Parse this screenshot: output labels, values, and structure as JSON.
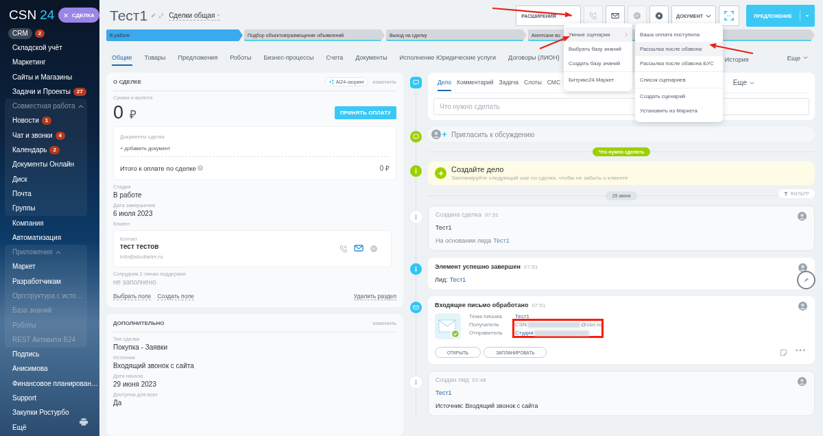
{
  "sidebar": {
    "logo": {
      "name": "CSN",
      "number": "24"
    },
    "close_button": {
      "icon": "×",
      "label": "СДЕЛКА"
    },
    "items": [
      {
        "kind": "link",
        "label": "CRM",
        "badge": "2",
        "selected": true,
        "dimmed": false
      },
      {
        "kind": "link",
        "label": "Складской учёт",
        "selected": false,
        "dimmed": false
      },
      {
        "kind": "link",
        "label": "Маркетинг",
        "selected": false,
        "dimmed": false
      },
      {
        "kind": "link",
        "label": "Сайты и Магазины",
        "selected": false,
        "dimmed": false
      },
      {
        "kind": "link",
        "label": "Задачи и Проекты",
        "badge": "27",
        "selected": false,
        "dimmed": false
      },
      {
        "kind": "group",
        "label": "Совместная работа",
        "expanded": true,
        "selected": false,
        "dimmed": true,
        "children": [
          {
            "kind": "link",
            "label": "Новости",
            "badge": "1",
            "selected": false,
            "dimmed": false
          },
          {
            "kind": "link",
            "label": "Чат и звонки",
            "badge": "4",
            "selected": false,
            "dimmed": false
          },
          {
            "kind": "link",
            "label": "Календарь",
            "badge": "2",
            "selected": false,
            "dimmed": false
          },
          {
            "kind": "link",
            "label": "Документы Онлайн",
            "selected": false,
            "dimmed": false
          },
          {
            "kind": "link",
            "label": "Диск",
            "selected": false,
            "dimmed": false
          },
          {
            "kind": "link",
            "label": "Почта",
            "selected": false,
            "dimmed": false
          },
          {
            "kind": "link",
            "label": "Группы",
            "selected": false,
            "dimmed": false
          }
        ]
      },
      {
        "kind": "link",
        "label": "Компания",
        "selected": false,
        "dimmed": false
      },
      {
        "kind": "link",
        "label": "Автоматизация",
        "selected": false,
        "dimmed": false
      },
      {
        "kind": "group",
        "label": "Приложения",
        "expanded": true,
        "selected": false,
        "dimmed": true,
        "children": [
          {
            "kind": "link",
            "label": "Маркет",
            "selected": false,
            "dimmed": false
          },
          {
            "kind": "link",
            "label": "Разработчикам",
            "selected": false,
            "dimmed": false
          },
          {
            "kind": "link",
            "label": "Оргструктура с исто…",
            "selected": false,
            "dimmed": true
          },
          {
            "kind": "link",
            "label": "База знаний",
            "selected": false,
            "dimmed": true
          },
          {
            "kind": "link",
            "label": "Роботы",
            "selected": false,
            "dimmed": true
          },
          {
            "kind": "link",
            "label": "REST Активити Б24",
            "selected": false,
            "dimmed": true
          }
        ]
      },
      {
        "kind": "link",
        "label": "Подпись",
        "selected": false,
        "dimmed": false
      },
      {
        "kind": "link",
        "label": "Анисимова",
        "selected": false,
        "dimmed": false
      },
      {
        "kind": "link",
        "label": "Финансовое планирован…",
        "selected": false,
        "dimmed": false
      },
      {
        "kind": "link",
        "label": "Support",
        "selected": false,
        "dimmed": false
      },
      {
        "kind": "link",
        "label": "Закупки Ростурбо",
        "selected": false,
        "dimmed": false
      },
      {
        "kind": "link",
        "label": "Ещё",
        "selected": false,
        "dimmed": false
      }
    ]
  },
  "header": {
    "title": "Тест1",
    "category": "Сделки общая"
  },
  "toolbar": {
    "extensions": "РАСШИРЕНИЯ",
    "icon_buttons": [
      {
        "disabled": true
      },
      {
        "disabled": false
      },
      {
        "disabled": true
      },
      {
        "disabled": false
      }
    ],
    "document": "ДОКУМЕНТ",
    "primary": "ПРЕДЛОЖЕНИЕ"
  },
  "extensions_menu": {
    "sections": [
      [
        {
          "label": "Умные сценарии",
          "hovered": true,
          "has_submenu": true
        },
        {
          "label": "Выбрать базу знаний",
          "hovered": false,
          "has_submenu": false
        },
        {
          "label": "Создать базу знаний",
          "hovered": false,
          "has_submenu": false
        }
      ],
      [
        {
          "label": "Битрикс24.Маркет",
          "hovered": false,
          "has_submenu": false
        }
      ]
    ]
  },
  "scenarios_menu": {
    "sections": [
      [
        {
          "label": "Ваша оплата поступила",
          "hovered": false
        },
        {
          "label": "Рассылка после обзвона",
          "hovered": true
        },
        {
          "label": "Рассылка после обзвона БУС",
          "hovered": false
        }
      ],
      [
        {
          "label": "Список сценариев",
          "hovered": false
        }
      ],
      [
        {
          "label": "Создать сценарий",
          "hovered": false
        },
        {
          "label": "Установить из Маркета",
          "hovered": false
        }
      ]
    ]
  },
  "stages": [
    {
      "label": "В работе",
      "current": true
    },
    {
      "label": "Подбор объектов/размещение объявлений",
      "current": false
    },
    {
      "label": "Выход на сделку",
      "current": false
    },
    {
      "label": "Агентское во",
      "current": false
    }
  ],
  "tabs": [
    {
      "label": "Общие",
      "selected": true
    },
    {
      "label": "Товары",
      "selected": false
    },
    {
      "label": "Предложения",
      "selected": false
    },
    {
      "label": "Роботы",
      "selected": false
    },
    {
      "label": "Бизнес-процессы",
      "selected": false
    },
    {
      "label": "Счета",
      "selected": false
    },
    {
      "label": "Документы",
      "selected": false
    },
    {
      "label": "Исполнение Юридические услуги",
      "selected": false
    },
    {
      "label": "Договоры (ЛИОН)",
      "selected": false
    },
    {
      "label": "История",
      "selected": false
    }
  ],
  "tabs_more": "Еще",
  "about": {
    "title": "О СДЕЛКЕ",
    "scoring": "AI24-скоринг",
    "edit": "изменить",
    "amount_label": "Сумма и валюта",
    "amount": "0",
    "currency": "₽",
    "pay_button": "ПРИНЯТЬ ОПЛАТУ",
    "documents": {
      "label": "Документы сделки",
      "add": "+ добавить документ",
      "total_label": "Итого к оплате по сделке",
      "total": "0 ₽"
    },
    "fields": [
      {
        "kind": "text",
        "label": "Стадия",
        "value": "В работе"
      },
      {
        "kind": "text",
        "label": "Дата завершения",
        "value": "6 июля 2023"
      },
      {
        "kind": "client",
        "label": "Клиент",
        "contact_label": "Контакт",
        "name": "тест тестов",
        "email": "info@studiarim.ru"
      },
      {
        "kind": "empty",
        "label": "Сотрудник 2 линии поддержки",
        "value": "не заполнено"
      }
    ],
    "links": [
      "Выбрать поле",
      "Создать поле"
    ],
    "delete": "Удалить раздел"
  },
  "extra": {
    "title": "ДОПОЛНИТЕЛЬНО",
    "edit": "изменить",
    "fields": [
      {
        "label": "Тип сделки",
        "value": "Покупка - Заявки"
      },
      {
        "label": "Источник",
        "value": "Входящий звонок с сайта"
      },
      {
        "label": "Дата начала",
        "value": "29 июня 2023"
      },
      {
        "label": "Доступна для всех",
        "value": "Да"
      }
    ]
  },
  "timeline": {
    "composer": {
      "tabs": [
        {
          "label": "Дело",
          "selected": true
        },
        {
          "label": "Комментарий",
          "selected": false
        },
        {
          "label": "Задача",
          "selected": false
        },
        {
          "label": "Слоты",
          "selected": false
        },
        {
          "label": "СМС",
          "selected": false
        }
      ],
      "more": "Еще",
      "placeholder": "Что нужно сделать"
    },
    "invite": "Пригласить к обсуждению",
    "todo_badge": "Что нужно сделать",
    "create": {
      "title": "Создайте дело",
      "hint": "Запланируйте следующий шаг по сделке, чтобы не забыть о клиенте"
    },
    "date": "29 июня",
    "filter": "ФИЛЬТР",
    "entries": [
      {
        "kind": "info",
        "title": "Создана сделка",
        "time": "07:51",
        "lines": [
          {
            "text": "Тест1",
            "muted": false
          },
          {
            "text": "На основании лида",
            "link": "Тест1",
            "muted": true
          }
        ]
      },
      {
        "kind": "done",
        "title": "Элемент успешно завершен",
        "time": "07:51",
        "lines": [
          {
            "text": "Лид:",
            "link": "Тест1",
            "muted": false
          }
        ]
      },
      {
        "kind": "email",
        "title": "Входящее письмо обработано",
        "time": "07:51",
        "rows": [
          {
            "label": "Тема письма",
            "value": "Тест1",
            "link": true,
            "redacted": false,
            "framed": false
          },
          {
            "label": "Получатель",
            "value": "CSN",
            "suffix": "@csn.ru",
            "link": false,
            "redacted": true,
            "framed": true
          },
          {
            "label": "Отправитель",
            "value": "Студия",
            "link": true,
            "redacted": true,
            "framed": true
          }
        ],
        "buttons": [
          "ОТКРЫТЬ",
          "ЗАПЛАНИРОВАТЬ"
        ]
      },
      {
        "kind": "info",
        "title": "Создан лид",
        "time": "07:48",
        "lines": [
          {
            "link": "Тест1",
            "muted": false
          },
          {
            "text": "Источник: Входящий звонок с сайта",
            "muted": false
          }
        ]
      }
    ]
  }
}
